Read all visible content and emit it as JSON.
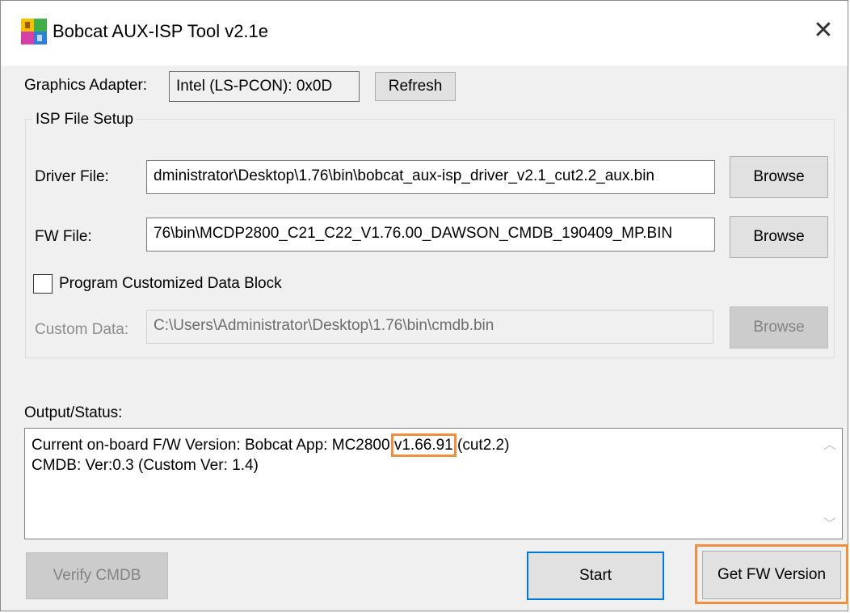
{
  "window": {
    "title": "Bobcat AUX-ISP Tool v2.1e",
    "close_glyph": "✕"
  },
  "adapter": {
    "label": "Graphics Adapter:",
    "value": "Intel (LS-PCON): 0x0D",
    "refresh_label": "Refresh"
  },
  "isp": {
    "group_label": "ISP File Setup",
    "driver_label": "Driver File:",
    "driver_value": "dministrator\\Desktop\\1.76\\bin\\bobcat_aux-isp_driver_v2.1_cut2.2_aux.bin",
    "fw_label": "FW File:",
    "fw_value": "76\\bin\\MCDP2800_C21_C22_V1.76.00_DAWSON_CMDB_190409_MP.BIN",
    "browse_label": "Browse",
    "program_cdb_label": "Program Customized Data Block",
    "program_cdb_checked": false,
    "custom_label": "Custom Data:",
    "custom_value": "C:\\Users\\Administrator\\Desktop\\1.76\\bin\\cmdb.bin"
  },
  "output": {
    "label": "Output/Status:",
    "line1_prefix": "Current on-board F/W Version: Bobcat App: MC2800 ",
    "line1_version": "v1.66.91",
    "line1_suffix": " (cut2.2)",
    "line2": "CMDB: Ver:0.3  (Custom Ver: 1.4)"
  },
  "buttons": {
    "verify_cmdb": "Verify CMDB",
    "start": "Start",
    "get_fw_version": "Get FW Version"
  },
  "colors": {
    "highlight": "#f0903e",
    "focus_border": "#0078d7"
  }
}
